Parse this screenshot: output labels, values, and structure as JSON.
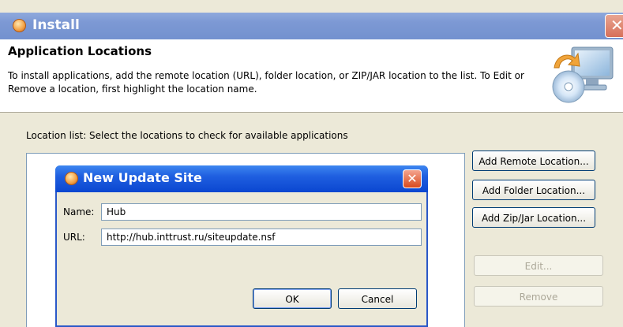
{
  "window": {
    "title": "Install",
    "close_glyph": "✕"
  },
  "header": {
    "title": "Application Locations",
    "description": "To install applications, add the remote location (URL), folder location, or ZIP/JAR location to the list. To Edit or Remove a location, first highlight the location name."
  },
  "location_list": {
    "label": "Location list: Select the locations to check for available applications"
  },
  "buttons": {
    "add_remote": "Add Remote Location...",
    "add_folder": "Add Folder Location...",
    "add_zip": "Add Zip/Jar Location...",
    "edit": "Edit...",
    "remove": "Remove"
  },
  "dialog": {
    "title": "New Update Site",
    "close_glyph": "✕",
    "name_label": "Name:",
    "name_value": "Hub",
    "url_label": "URL:",
    "url_value": "http://hub.inttrust.ru/siteupdate.nsf",
    "ok": "OK",
    "cancel": "Cancel"
  },
  "icons": {
    "title_icon": "app-flame-icon",
    "banner_icon": "computer-cd-install-icon"
  },
  "colors": {
    "outer_titlebar": "#7d99d4",
    "dialog_titlebar": "#1f5fe0",
    "window_bg": "#ece9d8"
  }
}
